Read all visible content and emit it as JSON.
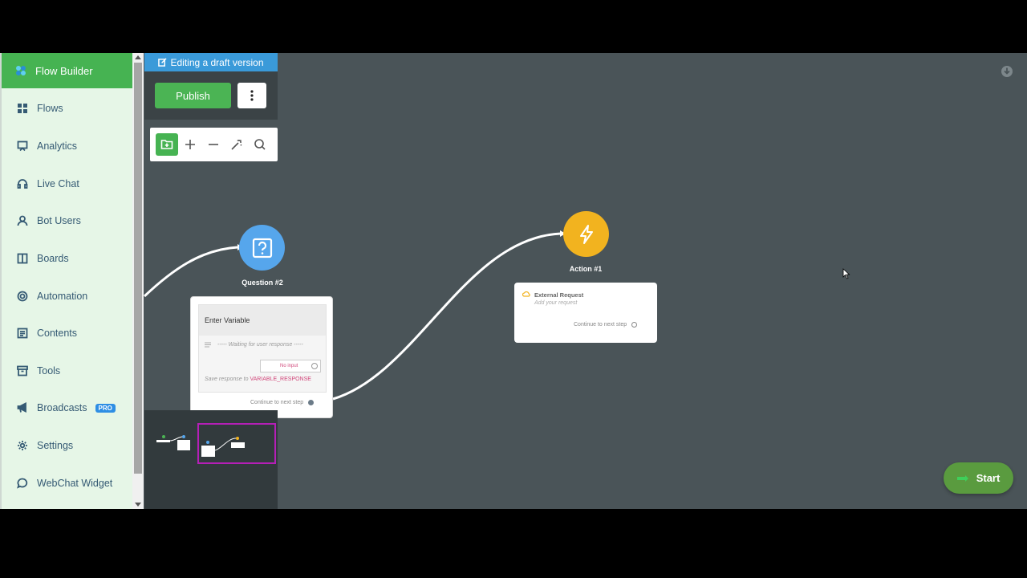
{
  "sidebar": {
    "brand": "Flow Builder",
    "items": [
      {
        "label": "Flows",
        "icon": "grid-icon"
      },
      {
        "label": "Analytics",
        "icon": "presentation-icon"
      },
      {
        "label": "Live Chat",
        "icon": "headset-icon"
      },
      {
        "label": "Bot Users",
        "icon": "user-icon"
      },
      {
        "label": "Boards",
        "icon": "columns-icon"
      },
      {
        "label": "Automation",
        "icon": "target-icon"
      },
      {
        "label": "Contents",
        "icon": "list-icon"
      },
      {
        "label": "Tools",
        "icon": "archive-icon"
      },
      {
        "label": "Broadcasts",
        "icon": "megaphone-icon",
        "badge": "PRO"
      },
      {
        "label": "Settings",
        "icon": "gear-icon"
      },
      {
        "label": "WebChat Widget",
        "icon": "chat-icon"
      }
    ]
  },
  "toolbar": {
    "draft_label": "Editing a draft version",
    "publish_label": "Publish"
  },
  "nodes": {
    "question": {
      "title": "Question #2",
      "card_header": "Enter Variable",
      "waiting": "----- Waiting for user response -----",
      "no_input": "No input",
      "save_prefix": "Save response to",
      "save_variable": "VARIABLE_RESPONSE",
      "continue": "Continue to next step"
    },
    "action": {
      "title": "Action #1",
      "card_title": "External Request",
      "card_subtitle": "Add your request",
      "continue": "Continue to next step"
    }
  },
  "fab": {
    "label": "Start"
  },
  "colors": {
    "brand_green": "#46b352",
    "question_blue": "#56a6ec",
    "action_yellow": "#f2b31f",
    "variable_pink": "#d1477a",
    "canvas": "#4a5458"
  }
}
